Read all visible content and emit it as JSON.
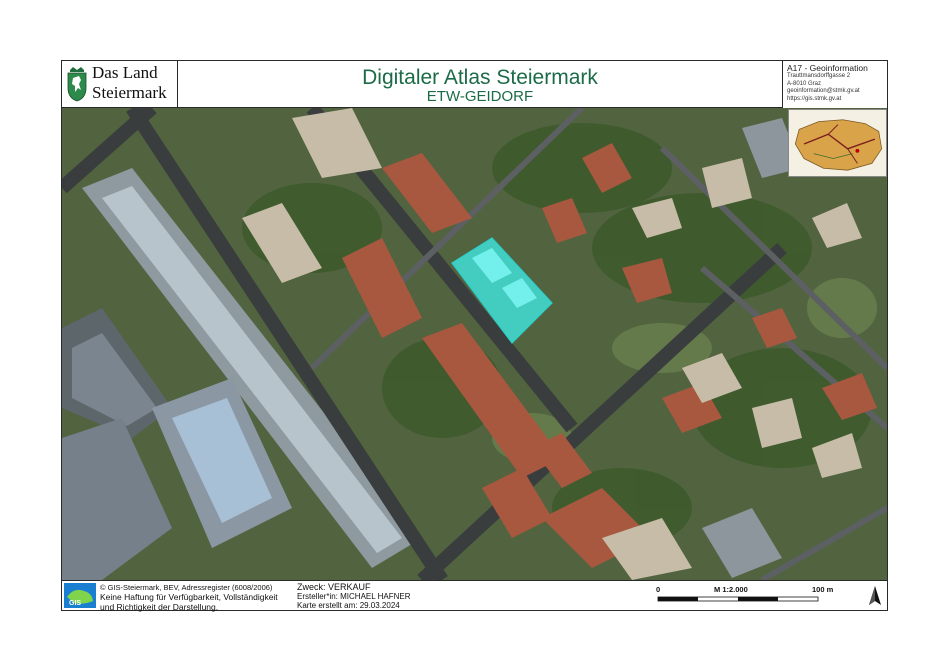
{
  "logo": {
    "line1": "Das Land",
    "line2": "Steiermark"
  },
  "title": {
    "main": "Digitaler Atlas Steiermark",
    "sub": "ETW-GEIDORF"
  },
  "org": {
    "name": "A17 - Geoinformation",
    "lines": [
      "Trauttmansdorffgasse 2",
      "A-8010 Graz",
      "geoinformation@stmk.gv.at",
      "https://gis.stmk.gv.at"
    ]
  },
  "footer": {
    "copyright": "© GIS-Steiermark, BEV, Adressregister (6008/2006)",
    "disclaimer1": "Keine Haftung für Verfügbarkeit, Vollständigkeit",
    "disclaimer2": "und Richtigkeit der Darstellung.",
    "zweck": "Zweck: VERKAUF",
    "ersteller": "Ersteller*in: MICHAEL HAFNER",
    "erstellt": "Karte erstellt am: 29.03.2024",
    "gis_logo_text": "GIS"
  },
  "scale": {
    "left": "0",
    "center": "M 1:2.000",
    "right": "100 m"
  },
  "colors": {
    "title_green": "#1c6b47",
    "highlight": "#3ff0ec",
    "frame": "#2a2a2a"
  },
  "icons": [
    "coat-of-arms-icon",
    "gis-logo-icon",
    "north-arrow-icon"
  ]
}
